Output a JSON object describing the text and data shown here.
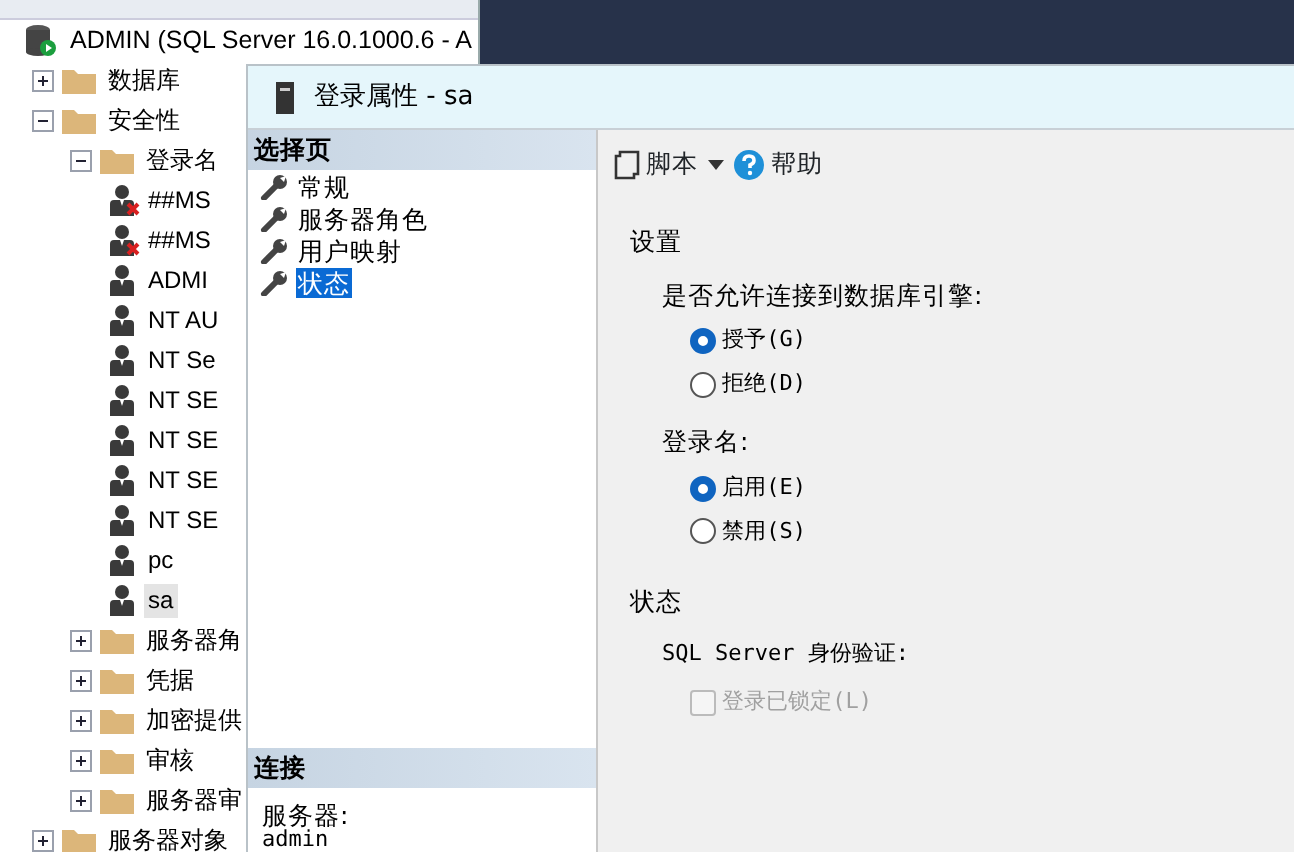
{
  "object_explorer": {
    "root": {
      "label": "ADMIN (SQL Server 16.0.1000.6 - A"
    },
    "items": [
      {
        "label": "数据库",
        "kind": "folder",
        "expanded": false
      },
      {
        "label": "安全性",
        "kind": "folder",
        "expanded": true,
        "children": [
          {
            "label": "登录名",
            "kind": "folder",
            "expanded": true,
            "children": [
              {
                "label": "##MS",
                "kind": "login",
                "disabled": true,
                "selected": false
              },
              {
                "label": "##MS",
                "kind": "login",
                "disabled": true,
                "selected": false
              },
              {
                "label": "ADMI",
                "kind": "login",
                "disabled": false,
                "selected": false
              },
              {
                "label": "NT AU",
                "kind": "login",
                "disabled": false,
                "selected": false
              },
              {
                "label": "NT Se",
                "kind": "login",
                "disabled": false,
                "selected": false
              },
              {
                "label": "NT SE",
                "kind": "login",
                "disabled": false,
                "selected": false
              },
              {
                "label": "NT SE",
                "kind": "login",
                "disabled": false,
                "selected": false
              },
              {
                "label": "NT SE",
                "kind": "login",
                "disabled": false,
                "selected": false
              },
              {
                "label": "NT SE",
                "kind": "login",
                "disabled": false,
                "selected": false
              },
              {
                "label": "pc",
                "kind": "login",
                "disabled": false,
                "selected": false
              },
              {
                "label": "sa",
                "kind": "login",
                "disabled": false,
                "selected": true
              }
            ]
          },
          {
            "label": "服务器角",
            "kind": "folder",
            "expanded": false
          },
          {
            "label": "凭据",
            "kind": "folder",
            "expanded": false
          },
          {
            "label": "加密提供",
            "kind": "folder",
            "expanded": false
          },
          {
            "label": "审核",
            "kind": "folder",
            "expanded": false
          },
          {
            "label": "服务器审",
            "kind": "folder",
            "expanded": false
          }
        ]
      },
      {
        "label": "服务器对象",
        "kind": "folder",
        "expanded": false
      }
    ]
  },
  "dialog": {
    "title": "登录属性 - sa",
    "select_page": {
      "header": "选择页",
      "pages": [
        {
          "label": "常规",
          "selected": false
        },
        {
          "label": "服务器角色",
          "selected": false
        },
        {
          "label": "用户映射",
          "selected": false
        },
        {
          "label": "状态",
          "selected": true
        }
      ]
    },
    "connection": {
      "header": "连接",
      "server_label": "服务器:",
      "server_value": "admin"
    },
    "toolbar": {
      "script": "脚本",
      "help": "帮助"
    },
    "settings": {
      "heading": "设置",
      "groups": [
        {
          "label": "是否允许连接到数据库引擎:",
          "options": [
            {
              "label": "授予(G)",
              "selected": true
            },
            {
              "label": "拒绝(D)",
              "selected": false
            }
          ]
        },
        {
          "label": "登录名:",
          "options": [
            {
              "label": "启用(E)",
              "selected": true
            },
            {
              "label": "禁用(S)",
              "selected": false
            }
          ]
        }
      ]
    },
    "status": {
      "heading": "状态",
      "label": "SQL Server 身份验证:",
      "lockout": {
        "label": "登录已锁定(L)",
        "checked": false,
        "disabled": true
      }
    }
  }
}
